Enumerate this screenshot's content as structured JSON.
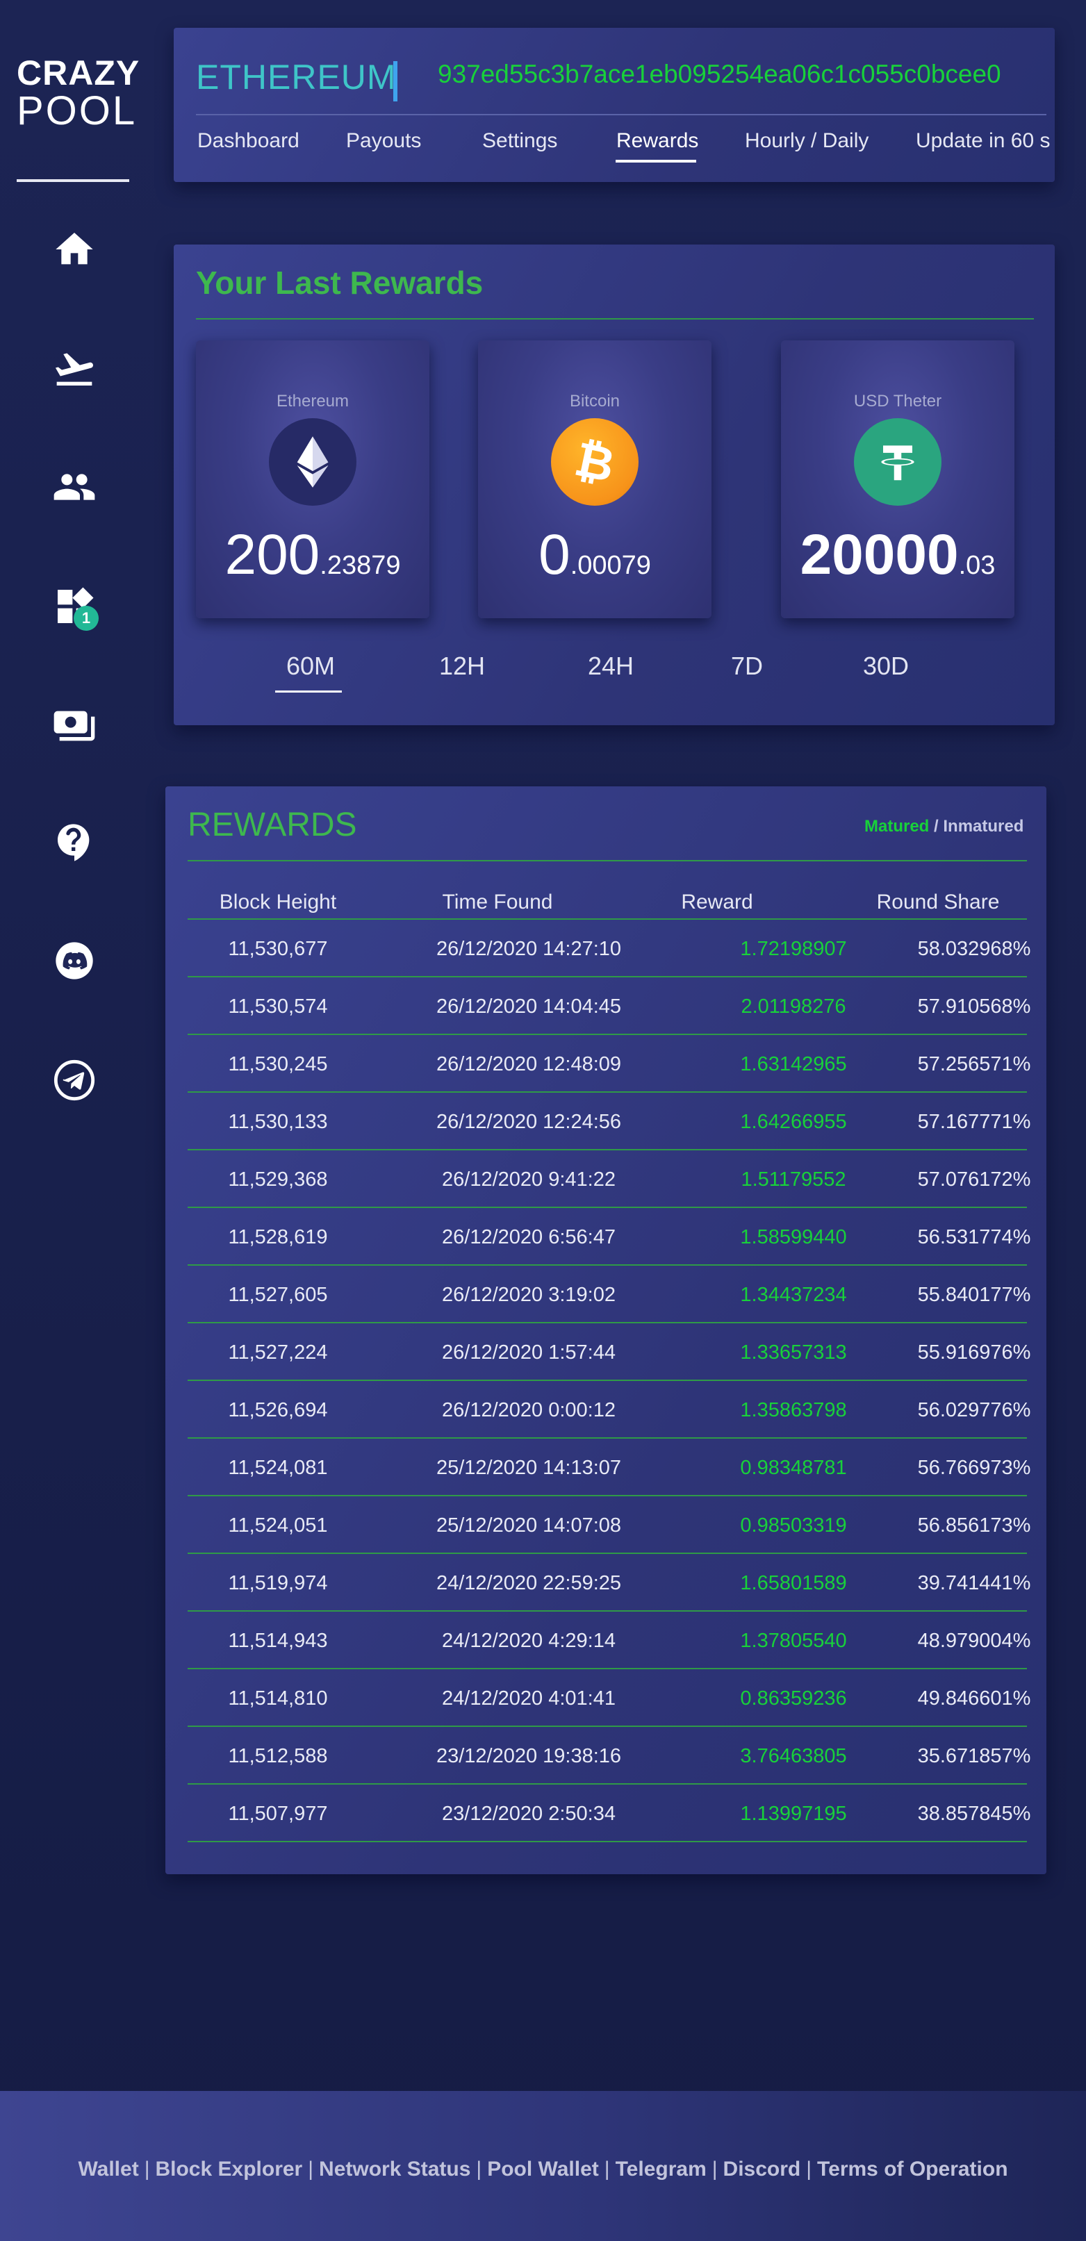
{
  "logo": {
    "line1": "CRAZY",
    "line2": "POOL"
  },
  "sidebar": {
    "items": [
      {
        "name": "home-icon"
      },
      {
        "name": "plane-icon"
      },
      {
        "name": "users-icon"
      },
      {
        "name": "apps-icon",
        "badge": "1"
      },
      {
        "name": "wallet-icon"
      },
      {
        "name": "help-icon"
      },
      {
        "name": "discord-icon"
      },
      {
        "name": "telegram-icon"
      }
    ]
  },
  "header": {
    "coin": "ETHEREUM",
    "address": "937ed55c3b7ace1eb095254ea06c1c055c0bcee0",
    "tabs": [
      {
        "label": "Dashboard"
      },
      {
        "label": "Payouts"
      },
      {
        "label": "Settings"
      },
      {
        "label": "Rewards",
        "active": true
      },
      {
        "label": "Hourly / Daily"
      },
      {
        "label": "Update in 60 s"
      }
    ]
  },
  "last_rewards": {
    "title": "Your Last Rewards",
    "cards": [
      {
        "name": "Ethereum",
        "int": "200",
        "dec": ".23879"
      },
      {
        "name": "Bitcoin",
        "int": "0",
        "dec": ".00079"
      },
      {
        "name": "USD Theter",
        "int": "20000",
        "dec": ".03"
      }
    ],
    "periods": [
      "60M",
      "12H",
      "24H",
      "7D",
      "30D"
    ],
    "active_period": "60M"
  },
  "rewards": {
    "title": "REWARDS",
    "legend": {
      "matured": "Matured",
      "separator": " / ",
      "immatured": "Inmatured"
    },
    "headers": [
      "Block Height",
      "Time Found",
      "Reward",
      "Round Share"
    ],
    "rows": [
      [
        "11,530,677",
        "26/12/2020 14:27:10",
        "1.72198907",
        "58.032968%"
      ],
      [
        "11,530,574",
        "26/12/2020 14:04:45",
        "2.01198276",
        "57.910568%"
      ],
      [
        "11,530,245",
        "26/12/2020 12:48:09",
        "1.63142965",
        "57.256571%"
      ],
      [
        "11,530,133",
        "26/12/2020 12:24:56",
        "1.64266955",
        "57.167771%"
      ],
      [
        "11,529,368",
        "26/12/2020 9:41:22",
        "1.51179552",
        "57.076172%"
      ],
      [
        "11,528,619",
        "26/12/2020 6:56:47",
        "1.58599440",
        "56.531774%"
      ],
      [
        "11,527,605",
        "26/12/2020 3:19:02",
        "1.34437234",
        "55.840177%"
      ],
      [
        "11,527,224",
        "26/12/2020 1:57:44",
        "1.33657313",
        "55.916976%"
      ],
      [
        "11,526,694",
        "26/12/2020 0:00:12",
        "1.35863798",
        "56.029776%"
      ],
      [
        "11,524,081",
        "25/12/2020 14:13:07",
        "0.98348781",
        "56.766973%"
      ],
      [
        "11,524,051",
        "25/12/2020 14:07:08",
        "0.98503319",
        "56.856173%"
      ],
      [
        "11,519,974",
        "24/12/2020 22:59:25",
        "1.65801589",
        "39.741441%"
      ],
      [
        "11,514,943",
        "24/12/2020 4:29:14",
        "1.37805540",
        "48.979004%"
      ],
      [
        "11,514,810",
        "24/12/2020 4:01:41",
        "0.86359236",
        "49.846601%"
      ],
      [
        "11,512,588",
        "23/12/2020 19:38:16",
        "3.76463805",
        "35.671857%"
      ],
      [
        "11,507,977",
        "23/12/2020 2:50:34",
        "1.13997195",
        "38.857845%"
      ]
    ]
  },
  "footer": {
    "links": [
      "Wallet",
      "Block Explorer",
      "Network Status",
      "Pool Wallet",
      "Telegram",
      "Discord",
      "Terms of Operation"
    ],
    "separator": "|"
  },
  "colors": {
    "accent_green": "#18d13a",
    "title_green": "#3eb84e",
    "coin_cyan": "#3fc5c8",
    "badge_teal": "#22b896"
  }
}
